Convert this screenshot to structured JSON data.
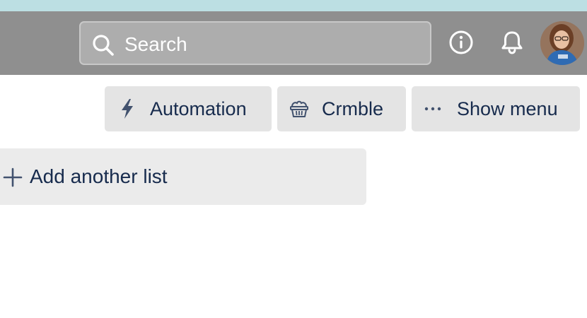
{
  "header": {
    "search": {
      "placeholder": "Search"
    },
    "info_icon": "info-icon",
    "notification_icon": "bell-icon",
    "avatar": "user-avatar"
  },
  "board_header": {
    "buttons": [
      {
        "label": "Automation",
        "icon": "lightning-icon"
      },
      {
        "label": "Crmble",
        "icon": "basket-icon"
      },
      {
        "label": "Show menu",
        "icon": "ellipsis-icon"
      }
    ]
  },
  "board": {
    "add_list_label": "Add another list",
    "add_list_icon": "plus-icon"
  },
  "colors": {
    "top_strip": "#bcdfe3",
    "header_bar": "#8f8f8f",
    "search_bg": "#adadad",
    "button_bg": "#e4e4e4",
    "add_list_bg": "#ebebeb",
    "text": "#172b4d"
  }
}
